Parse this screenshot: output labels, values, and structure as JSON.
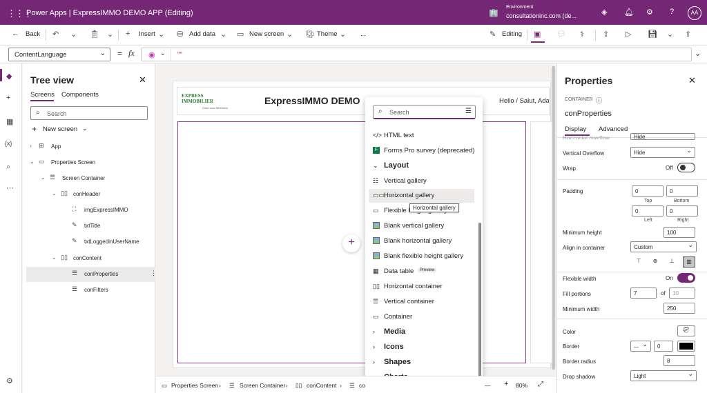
{
  "app": {
    "title": "Power Apps  |  ExpressIMMO DEMO APP (Editing)",
    "env_label": "Environment",
    "env_value": "consultationinc.com (de...",
    "avatar": "AA"
  },
  "cmdbar": {
    "back": "Back",
    "insert": "Insert",
    "add_data": "Add data",
    "new_screen": "New screen",
    "theme": "Theme",
    "more": "...",
    "editing": "Editing"
  },
  "formula": {
    "property": "ContentLanguage",
    "fx": "fx",
    "value": "\"\""
  },
  "tree": {
    "title": "Tree view",
    "tab_screens": "Screens",
    "tab_components": "Components",
    "search_placeholder": "Search",
    "new_screen": "New screen",
    "nodes": [
      {
        "label": "App"
      },
      {
        "label": "Properties Screen"
      },
      {
        "label": "Screen Container"
      },
      {
        "label": "conHeader"
      },
      {
        "label": "imgExpressIMMO"
      },
      {
        "label": "txtTitle"
      },
      {
        "label": "txtLoggedinUserName"
      },
      {
        "label": "conContent"
      },
      {
        "label": "conProperties"
      },
      {
        "label": "conFilters"
      }
    ]
  },
  "canvas": {
    "logo_line1": "EXPRESS",
    "logo_line2": "IMMOBILIER",
    "logo_tagline": "Chez vous fièrement",
    "header_title": "ExpressIMMO DEMO",
    "header_greeting": "Hello / Salut, Ada"
  },
  "popup": {
    "search_placeholder": "Search",
    "items": [
      {
        "label": "HTML text",
        "icon": "html-icon"
      },
      {
        "label": "Forms Pro survey (deprecated)",
        "icon": "forms-icon"
      },
      {
        "label": "Layout",
        "icon": "chevron-down-icon"
      },
      {
        "label": "Vertical gallery",
        "icon": "vertical-gallery-icon"
      },
      {
        "label": "Horizontal gallery",
        "icon": "horizontal-gallery-icon"
      },
      {
        "label": "Flexible height gallery",
        "icon": "flexible-gallery-icon"
      },
      {
        "label": "Blank vertical gallery",
        "icon": "blank-vertical-gallery-icon"
      },
      {
        "label": "Blank horizontal gallery",
        "icon": "blank-horizontal-gallery-icon"
      },
      {
        "label": "Blank flexible height gallery",
        "icon": "blank-flexible-gallery-icon"
      },
      {
        "label": "Data table",
        "icon": "table-icon",
        "badge": "Preview"
      },
      {
        "label": "Horizontal container",
        "icon": "horizontal-container-icon"
      },
      {
        "label": "Vertical container",
        "icon": "vertical-container-icon"
      },
      {
        "label": "Container",
        "icon": "container-icon"
      },
      {
        "label": "Media",
        "icon": "chevron-right-icon"
      },
      {
        "label": "Icons",
        "icon": "chevron-right-icon"
      },
      {
        "label": "Shapes",
        "icon": "chevron-right-icon"
      },
      {
        "label": "Charts",
        "icon": "chevron-right-icon"
      }
    ],
    "tooltip": "Horizontal gallery"
  },
  "breadcrumb": {
    "items": [
      "Properties Screen",
      "Screen Container",
      "conContent",
      "co"
    ],
    "zoom": "80%"
  },
  "properties": {
    "title": "Properties",
    "type": "CONTAINER",
    "name": "conProperties",
    "tab_display": "Display",
    "tab_advanced": "Advanced",
    "h_overflow_label": "Horizontal overflow",
    "h_overflow_value": "Hide",
    "v_overflow_label": "Vertical Overflow",
    "v_overflow_value": "Hide",
    "wrap_label": "Wrap",
    "wrap_state": "Off",
    "padding_label": "Padding",
    "pad_top": "0",
    "pad_bottom": "0",
    "pad_left": "0",
    "pad_right": "0",
    "top_lbl": "Top",
    "bottom_lbl": "Bottom",
    "left_lbl": "Left",
    "right_lbl": "Right",
    "min_height_label": "Minimum height",
    "min_height": "100",
    "align_label": "Align in container",
    "align_value": "Custom",
    "flex_width_label": "Flexible width",
    "flex_width_state": "On",
    "fill_label": "Fill portions",
    "fill_value": "7",
    "fill_of": "of",
    "fill_total": "10",
    "min_width_label": "Minimum width",
    "min_width": "250",
    "color_label": "Color",
    "border_label": "Border",
    "border_width": "0",
    "border_color": "#000000",
    "radius_label": "Border radius",
    "radius": "8",
    "shadow_label": "Drop shadow",
    "shadow": "Light"
  },
  "colors": {
    "brand": "#742774",
    "logo_green": "#2e7d32",
    "logo_tagline": "#555555"
  }
}
